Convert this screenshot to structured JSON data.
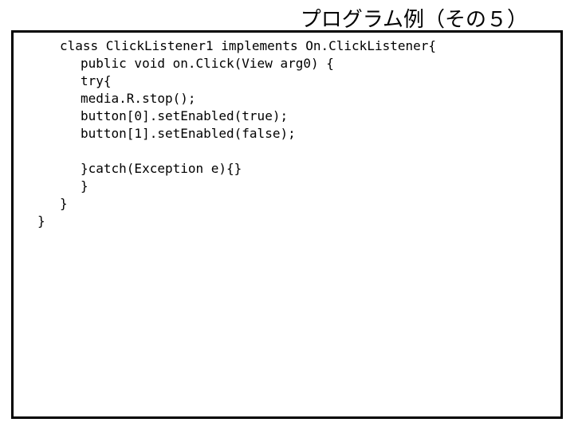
{
  "slide": {
    "title": "プログラム例（その５）"
  },
  "code": {
    "lines": [
      {
        "indent": "i2",
        "text": "class ClickListener1 implements On.ClickListener{"
      },
      {
        "indent": "i3",
        "text": "public void on.Click(View arg0) {"
      },
      {
        "indent": "i3",
        "text": "try{"
      },
      {
        "indent": "i3",
        "text": "media.R.stop();"
      },
      {
        "indent": "i3",
        "text": "button[0].setEnabled(true);"
      },
      {
        "indent": "i3",
        "text": "button[1].setEnabled(false);"
      },
      {
        "indent": "gap",
        "text": ""
      },
      {
        "indent": "i3",
        "text": "}catch(Exception e){}"
      },
      {
        "indent": "i3",
        "text": "}"
      },
      {
        "indent": "i2",
        "text": "}"
      },
      {
        "indent": "i1",
        "text": "}"
      }
    ]
  }
}
